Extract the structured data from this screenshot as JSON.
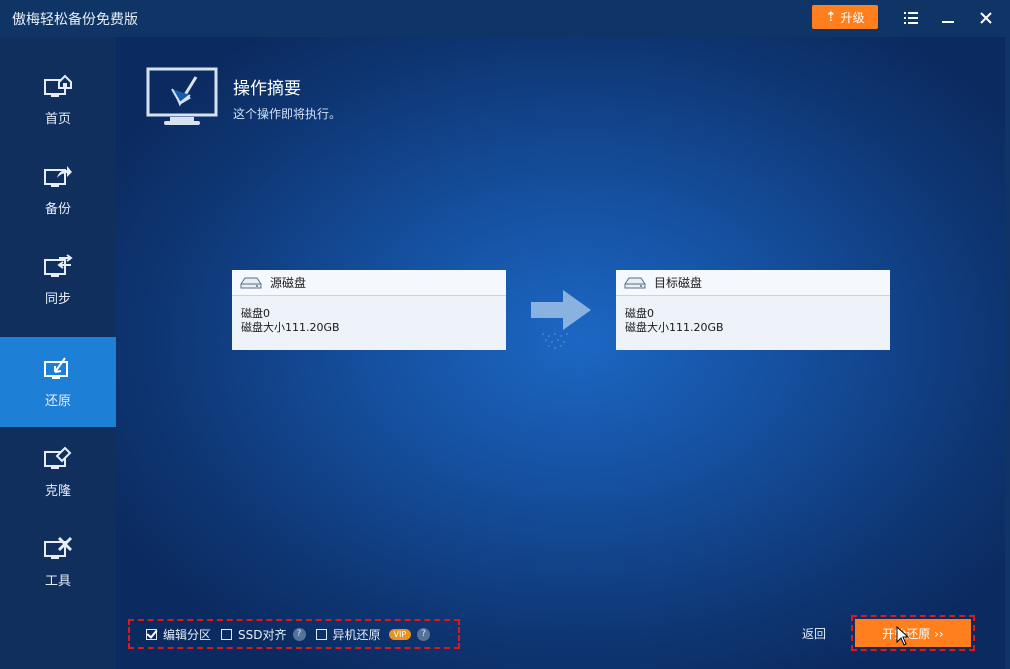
{
  "app": {
    "title": "傲梅轻松备份免费版",
    "upgrade_label": "升级"
  },
  "sidebar": {
    "items": [
      {
        "label": "首页",
        "icon": "home-monitor-icon"
      },
      {
        "label": "备份",
        "icon": "backup-monitor-icon"
      },
      {
        "label": "同步",
        "icon": "sync-monitor-icon"
      },
      {
        "label": "还原",
        "icon": "restore-monitor-icon",
        "active": true
      },
      {
        "label": "克隆",
        "icon": "clone-monitor-icon"
      },
      {
        "label": "工具",
        "icon": "tools-monitor-icon"
      }
    ]
  },
  "summary": {
    "title": "操作摘要",
    "subtitle": "这个操作即将执行。"
  },
  "source": {
    "header": "源磁盘",
    "line1": "磁盘0",
    "line2": "磁盘大小111.20GB"
  },
  "target": {
    "header": "目标磁盘",
    "line1": "磁盘0",
    "line2": "磁盘大小111.20GB"
  },
  "options": {
    "edit_partition": {
      "label": "编辑分区",
      "checked": true
    },
    "ssd_align": {
      "label": "SSD对齐",
      "checked": false
    },
    "universal_restore": {
      "label": "异机还原",
      "checked": false,
      "badge": "VIP"
    },
    "help_glyph": "?"
  },
  "footer": {
    "back_label": "返回",
    "start_label": "开始还原 ››"
  },
  "colors": {
    "accent_orange": "#ff7f1e",
    "sidebar_active": "#1e7fd6",
    "highlight_red": "#e2151b"
  }
}
